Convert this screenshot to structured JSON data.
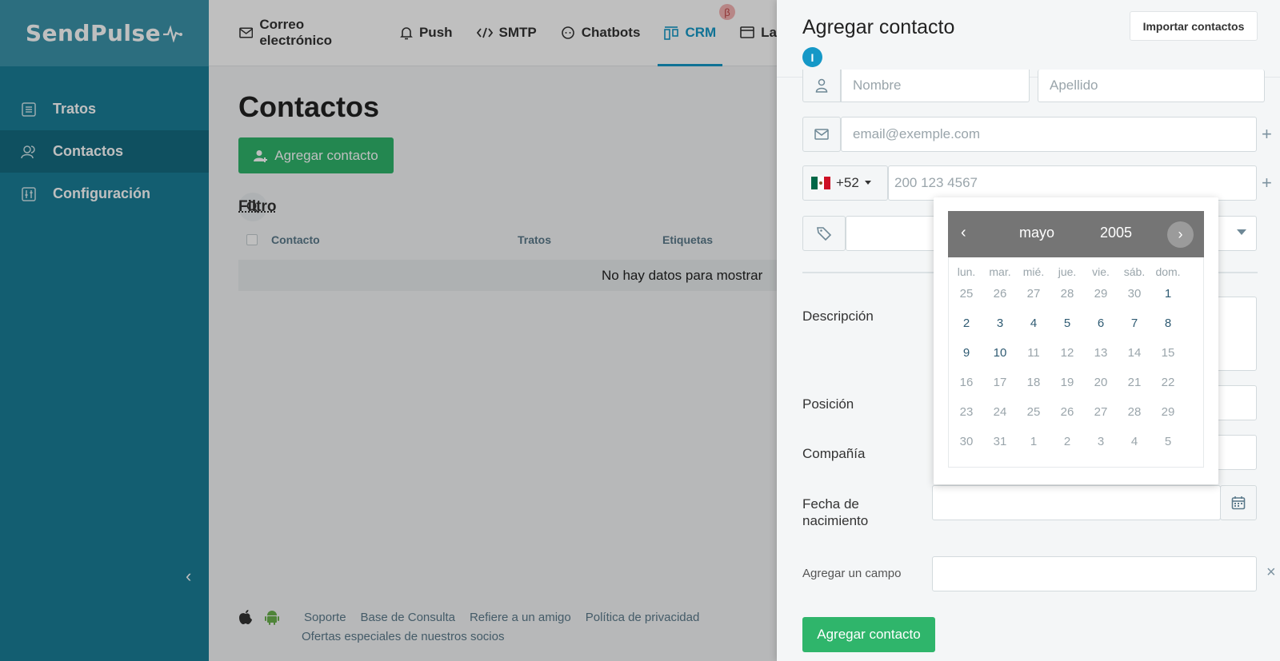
{
  "app": {
    "logo": "SendPulse"
  },
  "sidebar": {
    "items": [
      {
        "label": "Tratos",
        "icon": "list-icon"
      },
      {
        "label": "Contactos",
        "icon": "contacts-icon"
      },
      {
        "label": "Configuración",
        "icon": "settings-icon"
      }
    ],
    "collapse_glyph": "‹"
  },
  "topbar": {
    "tabs": [
      {
        "label": "Correo electrónico",
        "icon": "mail-icon"
      },
      {
        "label": "Push",
        "icon": "bell-icon"
      },
      {
        "label": "SMTP",
        "icon": "code-icon"
      },
      {
        "label": "Chatbots",
        "icon": "chat-icon"
      },
      {
        "label": "CRM",
        "icon": "crm-icon"
      },
      {
        "label": "La",
        "icon": "landing-icon"
      }
    ],
    "beta_badge": "β"
  },
  "main": {
    "title": "Contactos",
    "add_button": "Agregar contacto",
    "filter_label": "Filtro",
    "columns": [
      "Contacto",
      "Tratos",
      "Etiquetas"
    ],
    "empty_text": "No hay datos para mostrar"
  },
  "footer": {
    "links": [
      "Soporte",
      "Base de Consulta",
      "Refiere a un amigo",
      "Política de privacidad"
    ],
    "partners": "Ofertas especiales de nuestros socios"
  },
  "panel": {
    "title": "Agregar contacto",
    "import_button": "Importar contactos",
    "info_badge": "I",
    "first_name_placeholder": "Nombre",
    "last_name_placeholder": "Apellido",
    "email_placeholder": "email@exemple.com",
    "phone_code": "+52",
    "phone_placeholder": "200 123 4567",
    "labels": {
      "description": "Descripción",
      "position": "Posición",
      "company": "Compañía",
      "birthdate_line1": "Fecha de",
      "birthdate_line2": "nacimiento",
      "add_field": "Agregar un campo"
    },
    "submit_button": "Agregar contacto",
    "plus_glyph": "+",
    "close_glyph": "×"
  },
  "datepicker": {
    "month": "mayo",
    "year": "2005",
    "prev_glyph": "‹",
    "next_glyph": "›",
    "weekdays": [
      "lun.",
      "mar.",
      "mié.",
      "jue.",
      "vie.",
      "sáb.",
      "dom."
    ],
    "weeks": [
      [
        "25",
        "26",
        "27",
        "28",
        "29",
        "30",
        "1"
      ],
      [
        "2",
        "3",
        "4",
        "5",
        "6",
        "7",
        "8"
      ],
      [
        "9",
        "10",
        "11",
        "12",
        "13",
        "14",
        "15"
      ],
      [
        "16",
        "17",
        "18",
        "19",
        "20",
        "21",
        "22"
      ],
      [
        "23",
        "24",
        "25",
        "26",
        "27",
        "28",
        "29"
      ],
      [
        "30",
        "31",
        "1",
        "2",
        "3",
        "4",
        "5"
      ]
    ],
    "current_month_days": [
      [
        false,
        false,
        false,
        false,
        false,
        false,
        true
      ],
      [
        true,
        true,
        true,
        true,
        true,
        true,
        true
      ],
      [
        true,
        true,
        false,
        false,
        false,
        false,
        false
      ],
      [
        false,
        false,
        false,
        false,
        false,
        false,
        false
      ],
      [
        false,
        false,
        false,
        false,
        false,
        false,
        false
      ],
      [
        false,
        false,
        false,
        false,
        false,
        false,
        false
      ]
    ]
  },
  "colors": {
    "sidebar": "#1a7e97",
    "accent": "#1598c7",
    "green": "#2fb56b"
  }
}
